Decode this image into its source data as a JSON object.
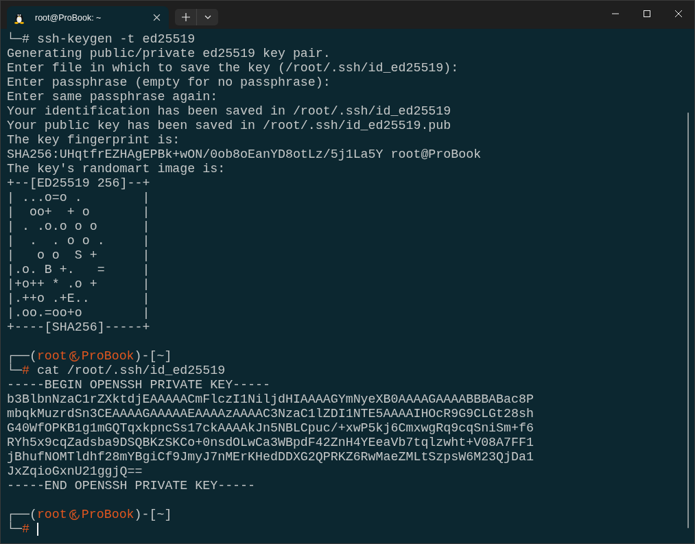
{
  "tab": {
    "title": "root@ProBook: ~",
    "selected": true
  },
  "lines": [
    {
      "kind": "command",
      "corner": "└─",
      "symbol": "#",
      "symbol_accent": false,
      "command": " ssh-keygen -t ed25519"
    },
    {
      "kind": "output",
      "text": "Generating public/private ed25519 key pair."
    },
    {
      "kind": "output",
      "text": "Enter file in which to save the key (/root/.ssh/id_ed25519):"
    },
    {
      "kind": "output",
      "text": "Enter passphrase (empty for no passphrase):"
    },
    {
      "kind": "output",
      "text": "Enter same passphrase again:"
    },
    {
      "kind": "output",
      "text": "Your identification has been saved in /root/.ssh/id_ed25519"
    },
    {
      "kind": "output",
      "text": "Your public key has been saved in /root/.ssh/id_ed25519.pub"
    },
    {
      "kind": "output",
      "text": "The key fingerprint is:"
    },
    {
      "kind": "output",
      "text": "SHA256:UHqtfrEZHAgEPBk+wON/0ob8oEanYD8otLz/5j1La5Y root@ProBook"
    },
    {
      "kind": "output",
      "text": "The key's randomart image is:"
    },
    {
      "kind": "output",
      "text": "+--[ED25519 256]--+"
    },
    {
      "kind": "output",
      "text": "| ...o=o .        |"
    },
    {
      "kind": "output",
      "text": "|  oo+  + o       |"
    },
    {
      "kind": "output",
      "text": "| . .o.o o o      |"
    },
    {
      "kind": "output",
      "text": "|  .  . o o .     |"
    },
    {
      "kind": "output",
      "text": "|   o o  S +      |"
    },
    {
      "kind": "output",
      "text": "|.o. B +.   =     |"
    },
    {
      "kind": "output",
      "text": "|+o++ * .o +      |"
    },
    {
      "kind": "output",
      "text": "|.++o .+E..       |"
    },
    {
      "kind": "output",
      "text": "|.oo.=oo+o        |"
    },
    {
      "kind": "output",
      "text": "+----[SHA256]-----+"
    },
    {
      "kind": "blank"
    },
    {
      "kind": "prompt",
      "segments": [
        {
          "kind": "frame",
          "text": "┌──("
        },
        {
          "kind": "user",
          "text": "root"
        },
        {
          "kind": "symbol"
        },
        {
          "kind": "host",
          "text": "ProBook"
        },
        {
          "kind": "frame",
          "text": ")-[~]"
        }
      ]
    },
    {
      "kind": "command",
      "corner": "└─",
      "symbol": "#",
      "symbol_accent": true,
      "command": " cat /root/.ssh/id_ed25519"
    },
    {
      "kind": "output",
      "text": "-----BEGIN OPENSSH PRIVATE KEY-----"
    },
    {
      "kind": "output",
      "text": "b3BlbnNzaC1rZXktdjEAAAAACmFlczI1NiljdHIAAAAGYmNyeXB0AAAAGAAAABBBABac8P"
    },
    {
      "kind": "output",
      "text": "mbqkMuzrdSn3CEAAAAGAAAAAEAAAAzAAAAC3NzaC1lZDI1NTE5AAAAIHOcR9G9CLGt28sh"
    },
    {
      "kind": "output",
      "text": "G40WfOPKB1g1mGQTqxkpncSs17ckAAAAkJn5NBLCpuc/+xwP5kj6CmxwgRq9cqSniSm+f6"
    },
    {
      "kind": "output",
      "text": "RYh5x9cqZadsba9DSQBKzSKCo+0nsdOLwCa3WBpdF42ZnH4YEeaVb7tqlzwht+V08A7FF1"
    },
    {
      "kind": "output",
      "text": "jBhufNOMTldhf28mYBgiCf9JmyJ7nMErKHedDDXG2QPRKZ6RwMaeZMLtSzpsW6M23QjDa1"
    },
    {
      "kind": "output",
      "text": "JxZqioGxnU21ggjQ=="
    },
    {
      "kind": "output",
      "text": "-----END OPENSSH PRIVATE KEY-----"
    },
    {
      "kind": "blank"
    },
    {
      "kind": "prompt",
      "segments": [
        {
          "kind": "frame",
          "text": "┌──("
        },
        {
          "kind": "user",
          "text": "root"
        },
        {
          "kind": "symbol"
        },
        {
          "kind": "host",
          "text": "ProBook"
        },
        {
          "kind": "frame",
          "text": ")-[~]"
        }
      ]
    },
    {
      "kind": "command",
      "corner": "└─",
      "symbol": "#",
      "symbol_accent": true,
      "cursor": true
    }
  ]
}
